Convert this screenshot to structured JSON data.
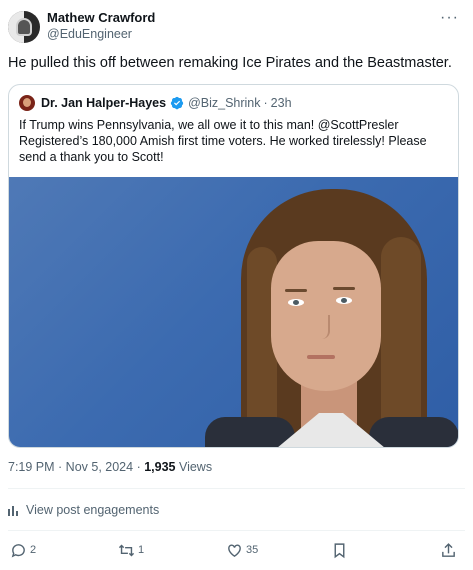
{
  "author": {
    "display_name": "Mathew Crawford",
    "handle": "@EduEngineer"
  },
  "more_label": "···",
  "tweet_text": "He pulled this off between remaking Ice Pirates and the Beastmaster.",
  "quote": {
    "display_name": "Dr. Jan Halper-Hayes",
    "handle": "@Biz_Shrink",
    "separator": "·",
    "time": "23h",
    "text": "If Trump wins Pennsylvania, we all owe it to this man! @ScottPresler Registered’s 180,000 Amish first time voters. He worked tirelessly! Please send a thank you to Scott!"
  },
  "meta": {
    "time": "7:19 PM",
    "sep1": " · ",
    "date": "Nov 5, 2024",
    "sep2": " · ",
    "views_count": "1,935",
    "views_label": " Views"
  },
  "engagements_label": "View post engagements",
  "actions": {
    "replies": "2",
    "reposts": "1",
    "likes": "35"
  },
  "colors": {
    "text_primary": "#0f1419",
    "text_secondary": "#536471",
    "verified_blue": "#1d9bf0",
    "border": "#cfd9de"
  },
  "icons": [
    "more-icon",
    "verified-badge-icon",
    "analytics-icon",
    "reply-icon",
    "repost-icon",
    "like-icon",
    "bookmark-icon",
    "share-icon"
  ]
}
